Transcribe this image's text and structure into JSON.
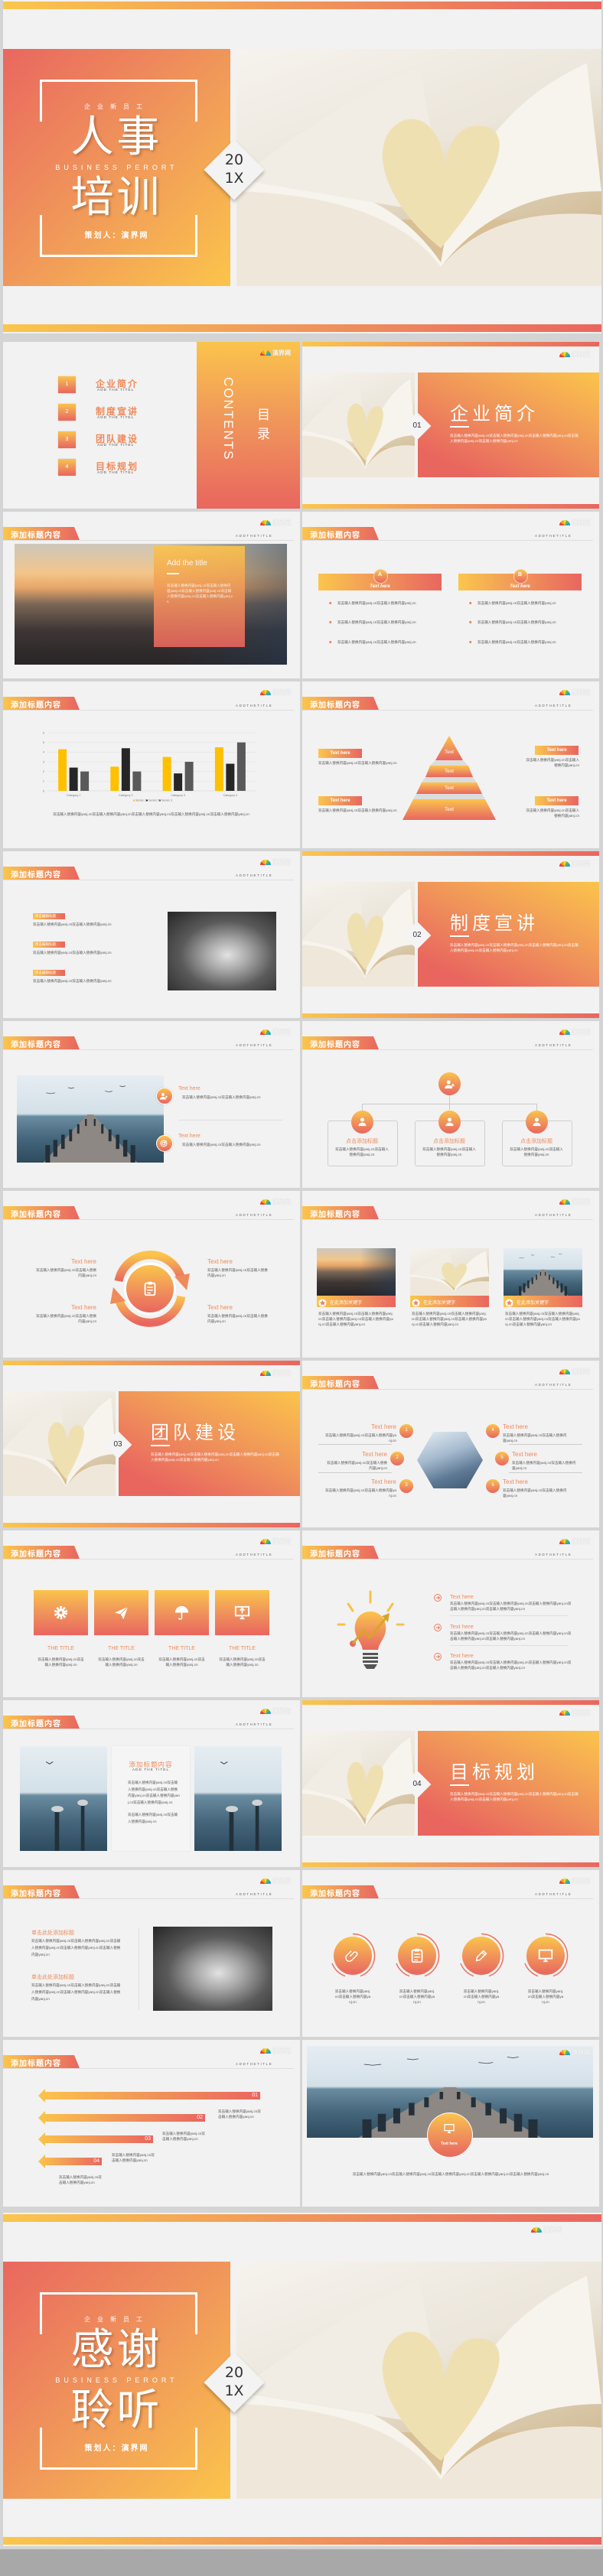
{
  "common": {
    "header_title": "添加标题内容",
    "header_subtitle": "ADDTHETITLE",
    "logo_text": "演界网",
    "placeholder": "双击输入替换内容yanj.cn双击输入替换内容yanj.cn双击输入替换内容yanj.cn双击输入替换内容yanj.cn双击输入替换内容yanj.cn",
    "placeholder_short": "双击输入替换内容yanj.cn双击输入替换内容yanj.cn",
    "text_here": "Text here"
  },
  "colors": {
    "gradient_start": "#fbc44b",
    "gradient_end": "#e9665f",
    "slide_background": "#f2f2f2",
    "page_background": "#d4d4d4"
  },
  "cover": {
    "kicker": "企业新员工",
    "title_line1": "人事",
    "subtitle": "BUSINESS PERORT",
    "title_line2": "培训",
    "author": "策划人：演界网",
    "year_line1": "20",
    "year_line2": "1X"
  },
  "contents": {
    "heading_cn": "目录",
    "heading_en": "CONTENTS",
    "items": [
      {
        "num": "1",
        "title": "企业简介",
        "sub": "ADD THE TITEL"
      },
      {
        "num": "2",
        "title": "制度宣讲",
        "sub": "ADD THE TITEL"
      },
      {
        "num": "3",
        "title": "团队建设",
        "sub": "ADD THE TITEL"
      },
      {
        "num": "4",
        "title": "目标规划",
        "sub": "ADD THE TITEL"
      }
    ]
  },
  "sections": [
    {
      "num": "01",
      "title": "企业简介"
    },
    {
      "num": "02",
      "title": "制度宣讲"
    },
    {
      "num": "03",
      "title": "团队建设"
    },
    {
      "num": "04",
      "title": "目标规划"
    }
  ],
  "photo_title": {
    "title": "Add the title"
  },
  "ab_columns": {
    "cols": [
      {
        "badge": "A",
        "label": "Text here"
      },
      {
        "badge": "B",
        "label": "Text here"
      }
    ]
  },
  "chart_data": {
    "type": "bar",
    "categories": [
      "Category 1",
      "Category 2",
      "Category 3",
      "Category 4"
    ],
    "series": [
      {
        "name": "Series 1",
        "values": [
          4.3,
          2.5,
          3.5,
          4.5
        ],
        "color": "#ffc000"
      },
      {
        "name": "Series 2",
        "values": [
          2.4,
          4.4,
          1.8,
          2.8
        ],
        "color": "#262626"
      },
      {
        "name": "Series 3",
        "values": [
          2,
          2,
          3,
          5
        ],
        "color": "#595959"
      }
    ],
    "ylim": [
      0,
      6
    ],
    "y_ticks": [
      "0",
      "1",
      "2",
      "3",
      "4",
      "5",
      "6"
    ],
    "grid": true,
    "legend": "bottom"
  },
  "pyramid": {
    "levels": [
      "Text",
      "Text",
      "Text",
      "Text"
    ],
    "labels": [
      "Text here",
      "Text here",
      "Text here",
      "Text here"
    ]
  },
  "handshake_list": {
    "tags": [
      "单击编辑标题",
      "单击编辑标题",
      "单击编辑标题"
    ]
  },
  "pier_items": {
    "items": [
      {
        "title": "Text here",
        "icon": "user-add-icon"
      },
      {
        "title": "Text here",
        "icon": "target-icon"
      }
    ]
  },
  "org_chart": {
    "boxes": [
      {
        "title": "点击添加标题"
      },
      {
        "title": "点击添加标题"
      },
      {
        "title": "点击添加标题"
      }
    ]
  },
  "cycle": {
    "labels": [
      "Text here",
      "Text here",
      "Text here",
      "Text here"
    ]
  },
  "photo_cards": {
    "cards": [
      {
        "caption": "在此添加关键字"
      },
      {
        "caption": "在此添加关键字"
      },
      {
        "caption": "在此添加关键字"
      }
    ]
  },
  "team_six": {
    "items": [
      {
        "num": "1",
        "title": "Text here"
      },
      {
        "num": "2",
        "title": "Text here"
      },
      {
        "num": "3",
        "title": "Text here"
      },
      {
        "num": "4",
        "title": "Text here"
      },
      {
        "num": "5",
        "title": "Text here"
      },
      {
        "num": "6",
        "title": "Text here"
      }
    ]
  },
  "icon_tiles": {
    "tiles": [
      {
        "icon": "gear-icon",
        "title": "THE TITLE"
      },
      {
        "icon": "paper-plane-icon",
        "title": "THE TITLE"
      },
      {
        "icon": "umbrella-icon",
        "title": "THE TITLE"
      },
      {
        "icon": "monitor-upload-icon",
        "title": "THE TITLE"
      }
    ]
  },
  "bulb": {
    "items": [
      "Text here",
      "Text here",
      "Text here"
    ]
  },
  "sea_triptych": {
    "title": "添加标题内容",
    "sub": "ADD THE TITEL"
  },
  "handshake_two": {
    "items": [
      "单击此处添加标题",
      "单击此处添加标题"
    ]
  },
  "circle_icons": {
    "items": [
      {
        "icon": "paperclip-icon"
      },
      {
        "icon": "clipboard-icon"
      },
      {
        "icon": "pencil-icon"
      },
      {
        "icon": "monitor-icon"
      }
    ]
  },
  "arrows": {
    "items": [
      "01",
      "02",
      "03",
      "04"
    ]
  },
  "pier_banner": {
    "label": "Text here"
  },
  "thanks": {
    "kicker": "企业新员工",
    "title_line1": "感谢",
    "subtitle": "BUSINESS PERORT",
    "title_line2": "聆听",
    "author": "策划人：演界网",
    "year_line1": "20",
    "year_line2": "1X"
  }
}
